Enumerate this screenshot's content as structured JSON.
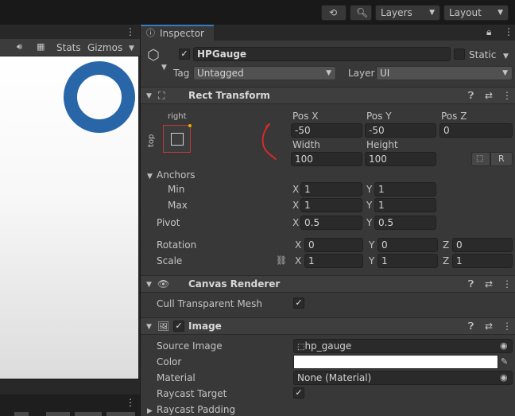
{
  "toolbar": {
    "history_icon": "history-icon",
    "search_icon": "search-icon",
    "layers_label": "Layers",
    "layout_label": "Layout"
  },
  "scene": {
    "stats_label": "Stats",
    "gizmos_label": "Gizmos",
    "gauge_color": "#2866a8"
  },
  "inspector": {
    "tab_label": "Inspector",
    "object_name": "HPGauge",
    "static_label": "Static",
    "tag_label": "Tag",
    "tag_value": "Untagged",
    "layer_label": "Layer",
    "layer_value": "UI"
  },
  "rect_transform": {
    "title": "Rect Transform",
    "anchor_preset_h": "right",
    "anchor_preset_v": "top",
    "pos_x_label": "Pos X",
    "pos_y_label": "Pos Y",
    "pos_z_label": "Pos Z",
    "pos_x": "-50",
    "pos_y": "-50",
    "pos_z": "0",
    "width_label": "Width",
    "height_label": "Height",
    "width": "100",
    "height": "100",
    "r_button": "R",
    "anchors_label": "Anchors",
    "min_label": "Min",
    "max_label": "Max",
    "min_x": "1",
    "min_y": "1",
    "max_x": "1",
    "max_y": "1",
    "pivot_label": "Pivot",
    "pivot_x": "0.5",
    "pivot_y": "0.5",
    "rotation_label": "Rotation",
    "rot_x": "0",
    "rot_y": "0",
    "rot_z": "0",
    "scale_label": "Scale",
    "scale_x": "1",
    "scale_y": "1",
    "scale_z": "1",
    "x": "X",
    "y": "Y",
    "z": "Z"
  },
  "canvas_renderer": {
    "title": "Canvas Renderer",
    "cull_label": "Cull Transparent Mesh",
    "cull_checked": "✓"
  },
  "image": {
    "title": "Image",
    "source_image_label": "Source Image",
    "source_image_value": "hp_gauge",
    "color_label": "Color",
    "color_value": "#ffffff",
    "material_label": "Material",
    "material_value": "None (Material)",
    "raycast_target_label": "Raycast Target",
    "raycast_padding_label": "Raycast Padding"
  },
  "annotation_color": "#d42a2a"
}
